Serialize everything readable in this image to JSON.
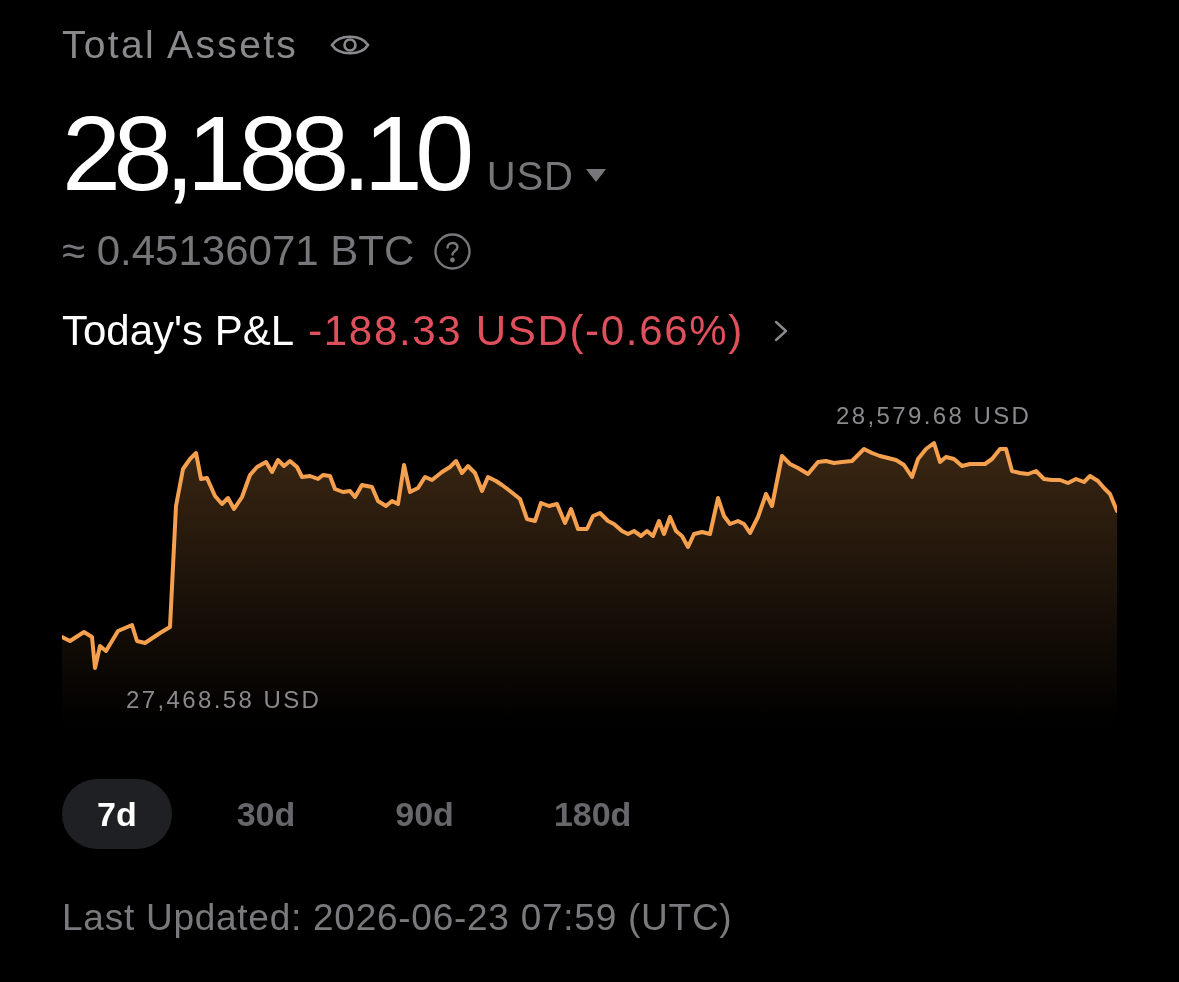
{
  "header": {
    "title": "Total Assets"
  },
  "balance": {
    "amount": "28,188.10",
    "currency": "USD"
  },
  "btc_equivalent": "≈ 0.45136071 BTC",
  "pnl": {
    "label": "Today's P&L",
    "value": "-188.33 USD(-0.66%)",
    "negative": true
  },
  "chart": {
    "max_label": "28,579.68 USD",
    "min_label": "27,468.58 USD"
  },
  "ranges": [
    {
      "label": "7d",
      "selected": true
    },
    {
      "label": "30d",
      "selected": false
    },
    {
      "label": "90d",
      "selected": false
    },
    {
      "label": "180d",
      "selected": false
    }
  ],
  "last_updated": "Last Updated: 2026-06-23 07:59 (UTC)"
}
